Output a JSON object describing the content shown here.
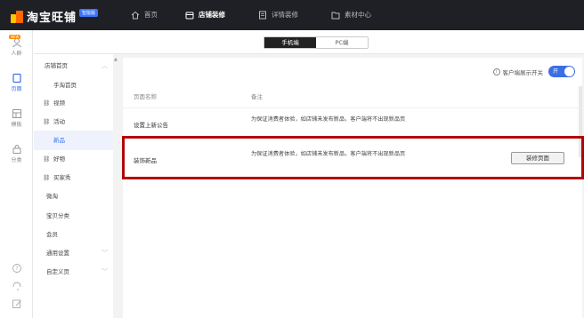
{
  "app": {
    "logo_text": "淘宝旺铺",
    "logo_badge": "智能版",
    "nav": [
      {
        "label": "首页",
        "icon": "home-icon"
      },
      {
        "label": "店铺装修",
        "icon": "store-icon"
      },
      {
        "label": "详情装修",
        "icon": "detail-icon"
      },
      {
        "label": "素材中心",
        "icon": "folder-icon"
      }
    ],
    "active_nav": "店铺装修"
  },
  "rail": {
    "badge": "NEW",
    "items": [
      {
        "label": "人群",
        "icon": "user-icon"
      },
      {
        "label": "页面",
        "icon": "page-icon"
      },
      {
        "label": "模板",
        "icon": "template-icon"
      },
      {
        "label": "分类",
        "icon": "category-icon"
      }
    ],
    "active": "页面",
    "bottom_icons": [
      "help-icon",
      "headset-icon",
      "edit-icon"
    ]
  },
  "mode_switch": {
    "options": [
      "手机端",
      "PC端"
    ],
    "selected": "手机端"
  },
  "page_list": {
    "items": [
      {
        "label": "店铺首页",
        "type": "group",
        "expanded": true
      },
      {
        "label": "手淘首页",
        "type": "child"
      },
      {
        "label": "视频",
        "type": "icon",
        "icon": "link-icon"
      },
      {
        "label": "活动",
        "type": "icon",
        "icon": "link-icon"
      },
      {
        "label": "新品",
        "type": "child",
        "active": true
      },
      {
        "label": "好物",
        "type": "icon",
        "icon": "link-icon"
      },
      {
        "label": "买家秀",
        "type": "icon",
        "icon": "link-icon"
      },
      {
        "label": "微淘",
        "type": "plain"
      },
      {
        "label": "宝贝分类",
        "type": "plain"
      },
      {
        "label": "会员",
        "type": "plain"
      },
      {
        "label": "通用设置",
        "type": "group",
        "expanded": false
      },
      {
        "label": "自定义页",
        "type": "group",
        "expanded": false
      }
    ]
  },
  "content": {
    "toggle_label": "客户端展示开关",
    "toggle_state": "开",
    "columns": {
      "name": "页面名称",
      "note": "备注"
    },
    "rows": [
      {
        "name": "设置上新公告",
        "note": "为保证消费者体验，如店铺未发布新品，客户端将不出现新品页",
        "action": ""
      },
      {
        "name": "装饰新品",
        "note": "为保证消费者体验，如店铺未发布新品，客户端将不出现新品页",
        "action": "装修页面"
      }
    ]
  },
  "colors": {
    "accent": "#3b6fe6",
    "topbar": "#1f2026",
    "highlight": "#b40000"
  }
}
